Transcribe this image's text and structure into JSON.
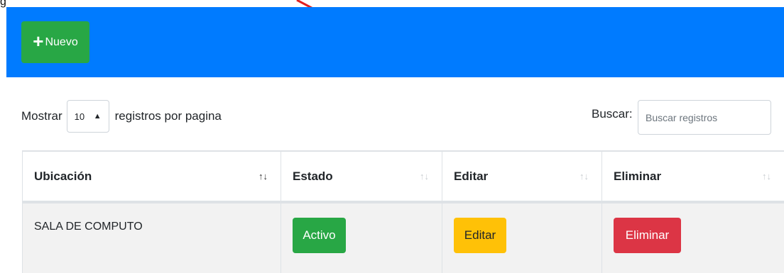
{
  "caption": "g",
  "header": {
    "new_button_label": "Nuevo",
    "color": "#007bff"
  },
  "length_control": {
    "prefix": "Mostrar",
    "selected": "10",
    "suffix": "registros por pagina"
  },
  "search": {
    "label": "Buscar:",
    "placeholder": "Buscar registros",
    "value": ""
  },
  "table": {
    "columns": [
      "Ubicación",
      "Estado",
      "Editar",
      "Eliminar"
    ],
    "rows": [
      {
        "ubicacion": "SALA DE COMPUTO",
        "estado": "Activo",
        "editar": "Editar",
        "eliminar": "Eliminar"
      }
    ]
  },
  "colors": {
    "success": "#28a745",
    "warning": "#ffc107",
    "danger": "#dc3545",
    "primary": "#007bff"
  },
  "icons": {
    "new": "plus-icon",
    "select": "sort-arrows-icon",
    "annotation": "red-arrow"
  }
}
